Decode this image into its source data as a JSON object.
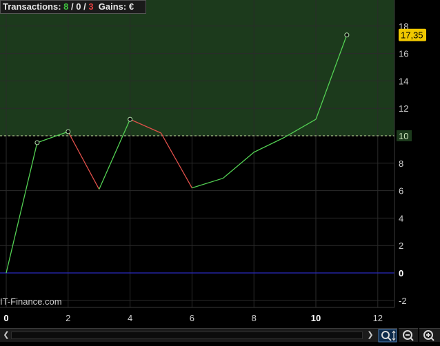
{
  "stats": {
    "label": "Transactions:",
    "wins": "8",
    "sep1": " / ",
    "neutral": "0",
    "sep2": " / ",
    "losses": "3",
    "gains_label": "Gains:",
    "currency": "€"
  },
  "watermark": "IT-Finance.com",
  "last_value_label": "17,35",
  "threshold_label": "10",
  "colors": {
    "up_line": "#53d053",
    "down_line": "#e0504a",
    "positive_zone": "#1c3a1c",
    "zero_line": "#2a2ac0",
    "threshold_line": "#c8e6a0",
    "last_badge": "#f0c800",
    "grid": "#2b2b2b"
  },
  "icons": {
    "scroll_left": "chevron-left-icon",
    "scroll_right": "chevron-right-icon",
    "zoom_fit": "zoom-fit-icon",
    "zoom_out": "zoom-out-icon",
    "zoom_in": "zoom-in-icon"
  },
  "chart_data": {
    "type": "line",
    "x": [
      0,
      1,
      2,
      3,
      4,
      5,
      6,
      7,
      8,
      9,
      10,
      11
    ],
    "y": [
      0,
      9.5,
      10.3,
      6.1,
      11.2,
      10.2,
      6.2,
      6.9,
      8.8,
      9.9,
      11.2,
      17.35
    ],
    "markers_at": [
      1,
      2,
      4,
      11
    ],
    "segment_direction": [
      "up",
      "up",
      "down",
      "up",
      "down",
      "down",
      "up",
      "up",
      "up",
      "up",
      "up"
    ],
    "threshold": 10,
    "xlim": [
      0,
      12.5
    ],
    "ylim": [
      -2,
      19
    ],
    "x_ticks": [
      "0",
      "2",
      "4",
      "6",
      "8",
      "10",
      "12"
    ],
    "y_ticks": [
      "-2",
      "0",
      "2",
      "4",
      "6",
      "8",
      "10",
      "12",
      "14",
      "16",
      "18"
    ],
    "grid": true
  }
}
